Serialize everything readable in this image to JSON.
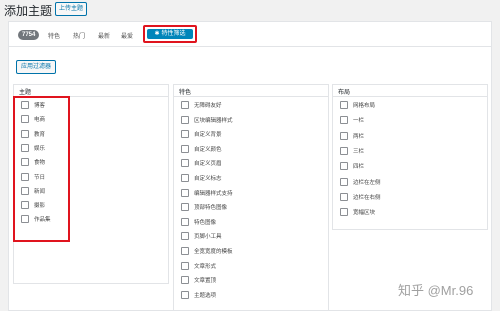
{
  "header": {
    "title": "添加主题",
    "upload_label": "上传主题"
  },
  "filter_bar": {
    "count": "7754",
    "tabs": [
      "特色",
      "热门",
      "最新",
      "最爱"
    ],
    "feature_filter_label": "特性筛选"
  },
  "apply_filter_label": "应用过滤器",
  "groups": {
    "subject": {
      "title": "主题",
      "items": [
        "博客",
        "电商",
        "教育",
        "娱乐",
        "食物",
        "节日",
        "新闻",
        "摄影",
        "作品集"
      ]
    },
    "features": {
      "title": "特色",
      "items": [
        "无障碍友好",
        "区块编辑器样式",
        "自定义背景",
        "自定义颜色",
        "自定义页眉",
        "自定义标志",
        "编辑器样式支持",
        "顶部特色图像",
        "特色图像",
        "页脚小工具",
        "全宽宽度的模板",
        "文章形式",
        "文章置顶",
        "主题选项"
      ]
    },
    "layout": {
      "title": "布局",
      "items": [
        "网格布局",
        "一栏",
        "两栏",
        "三栏",
        "四栏",
        "边栏在左侧",
        "边栏在右侧",
        "宽幅区块"
      ]
    }
  },
  "watermark": "知乎 @Mr.96",
  "colors": {
    "accent": "#0085ba",
    "highlight": "#e0141e"
  }
}
